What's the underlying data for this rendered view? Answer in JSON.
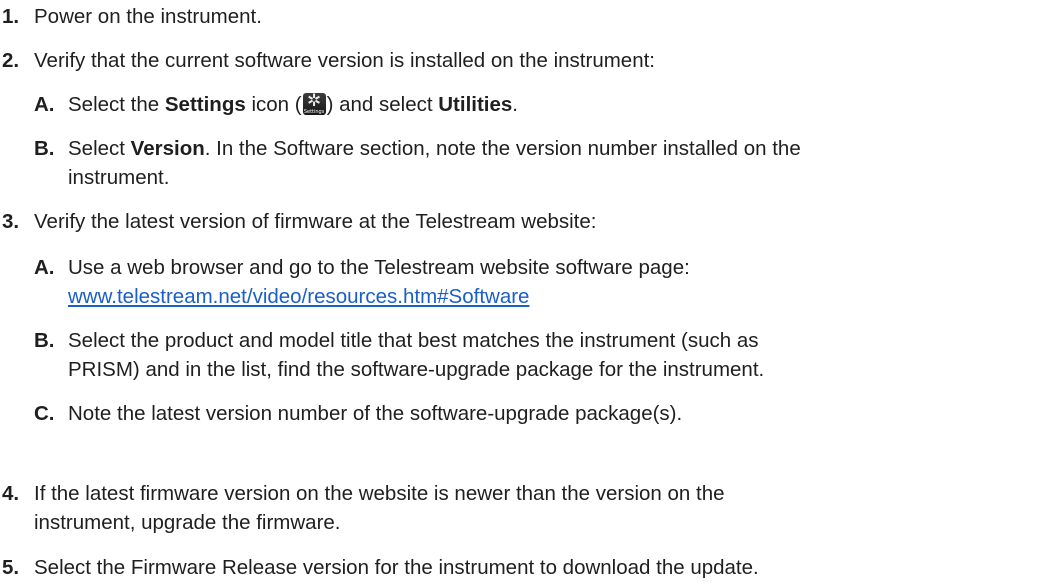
{
  "steps": [
    {
      "num": "1.",
      "text": "Power on the instrument."
    },
    {
      "num": "2.",
      "text": "Verify that the current software version is installed on the instrument:",
      "subs": [
        {
          "letter": "A.",
          "pre": "Select the ",
          "bold1": "Settings",
          "mid": " icon (",
          "icon_name": "settings-gear-icon",
          "icon_glyph": "✲",
          "icon_caption": "Settings",
          "post": ") and select ",
          "bold2": "Utilities",
          "end": "."
        },
        {
          "letter": "B.",
          "pre": "Select ",
          "bold1": "Version",
          "line1_rest": ". In the Software section, note the version number installed on the",
          "line2": "instrument."
        }
      ]
    },
    {
      "num": "3.",
      "text": "Verify the latest version of firmware at the Telestream website:",
      "subs": [
        {
          "letter": "A.",
          "line1": "Use a web browser and go to the Telestream website software page:",
          "link": "www.telestream.net/video/resources.htm#Software"
        },
        {
          "letter": "B.",
          "line1": "Select the product and model title that best matches the instrument (such as",
          "line2": "PRISM) and in the list, find the software-upgrade package for the instrument."
        },
        {
          "letter": "C.",
          "line1": "Note the latest version number of the software-upgrade package(s)."
        }
      ]
    },
    {
      "num": "4.",
      "line1": "If the latest firmware version on the website is newer than the version on the",
      "line2": "instrument, upgrade the firmware."
    },
    {
      "num": "5.",
      "text": "Select the Firmware Release version for the instrument to download the update."
    }
  ],
  "colors": {
    "text": "#1f1f1f",
    "link": "#1a5fc8"
  }
}
